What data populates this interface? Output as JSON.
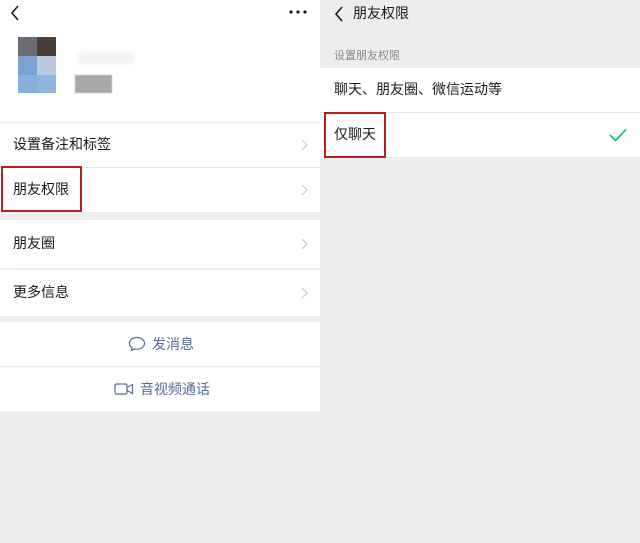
{
  "left": {
    "menu": [
      {
        "label": "设置备注和标签"
      },
      {
        "label": "朋友权限"
      },
      {
        "label": "朋友圈"
      },
      {
        "label": "更多信息"
      }
    ],
    "actions": [
      {
        "label": "发消息",
        "icon": "chat-bubble-icon"
      },
      {
        "label": "音视频通话",
        "icon": "video-camera-icon"
      }
    ]
  },
  "right": {
    "title": "朋友权限",
    "section_hint": "设置朋友权限",
    "options": [
      {
        "label": "聊天、朋友圈、微信运动等",
        "selected": false
      },
      {
        "label": "仅聊天",
        "selected": true
      }
    ]
  },
  "colors": {
    "link": "#576b95",
    "check": "#07c160",
    "highlight": "#b3201f",
    "background": "#ededed"
  }
}
